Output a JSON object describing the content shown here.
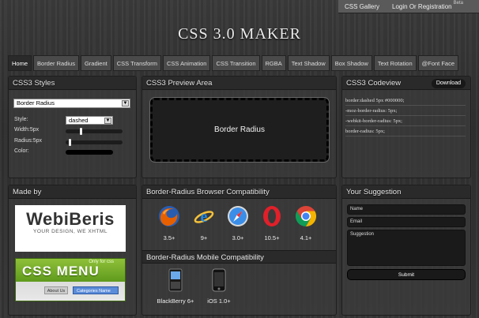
{
  "toplinks": {
    "gallery": "CSS Gallery",
    "login": "Login Or Registration",
    "beta": "Beta"
  },
  "logo": "CSS 3.0 MAKER",
  "nav": {
    "tabs": [
      "Home",
      "Border Radius",
      "Gradient",
      "CSS Transform",
      "CSS Animation",
      "CSS Transition",
      "RGBA",
      "Text Shadow",
      "Box Shadow",
      "Text Rotation",
      "@Font Face"
    ],
    "active": "Home"
  },
  "styles_panel": {
    "title": "CSS3 Styles",
    "selected_property": "Border Radius",
    "style_label": "Style:",
    "style_value": "dashed",
    "width_label": "Width:5px",
    "width_level": 0.25,
    "radius_label": "Radius:5px",
    "radius_level": 0.06,
    "color_label": "Color:",
    "color_value": "#000000"
  },
  "preview_panel": {
    "title": "CSS3 Preview Area",
    "preview_text": "Border Radius"
  },
  "code_panel": {
    "title": "CSS3 Codeview",
    "download_label": "Download",
    "lines": [
      "border:dashed 5px #000000;",
      "-moz-border-radius: 5px;",
      "-webkit-border-radius: 5px;",
      "border-radius: 5px;"
    ]
  },
  "made_by_panel": {
    "title": "Made by",
    "webiberis_name": "WebiBeris",
    "webiberis_tagline": "YOUR DESIGN, WE XHTML",
    "cssmenu_only": "Only for css",
    "cssmenu_title": "CSS MENU",
    "cssmenu_about": "About Us",
    "cssmenu_category": "Categories Name"
  },
  "compat_panel": {
    "title": "Border-Radius Browser Compatibility",
    "browsers": [
      {
        "icon": "firefox-icon",
        "version": "3.5+"
      },
      {
        "icon": "ie-icon",
        "version": "9+"
      },
      {
        "icon": "safari-icon",
        "version": "3.0+"
      },
      {
        "icon": "opera-icon",
        "version": "10.5+"
      },
      {
        "icon": "chrome-icon",
        "version": "4.1+"
      }
    ],
    "mobile_title": "Border-Radius Mobile Compatibility",
    "devices": [
      {
        "icon": "blackberry-icon",
        "version": "BlackBerry 6+"
      },
      {
        "icon": "iphone-icon",
        "version": "iOS 1.0+"
      }
    ]
  },
  "suggestion_panel": {
    "title": "Your Suggestion",
    "name_placeholder": "Name",
    "email_placeholder": "Email",
    "suggestion_placeholder": "Suggestion",
    "submit_label": "Submit"
  },
  "colors": {
    "background": "#333333",
    "panel": "#3c3c3c",
    "firefox": "#e66000",
    "ie": "#1e88e5",
    "safari": "#3b8ee8",
    "opera": "#e0202a",
    "chrome_red": "#db4437",
    "chrome_green": "#0f9d58",
    "chrome_yellow": "#f4b400",
    "chrome_blue": "#4285f4"
  }
}
